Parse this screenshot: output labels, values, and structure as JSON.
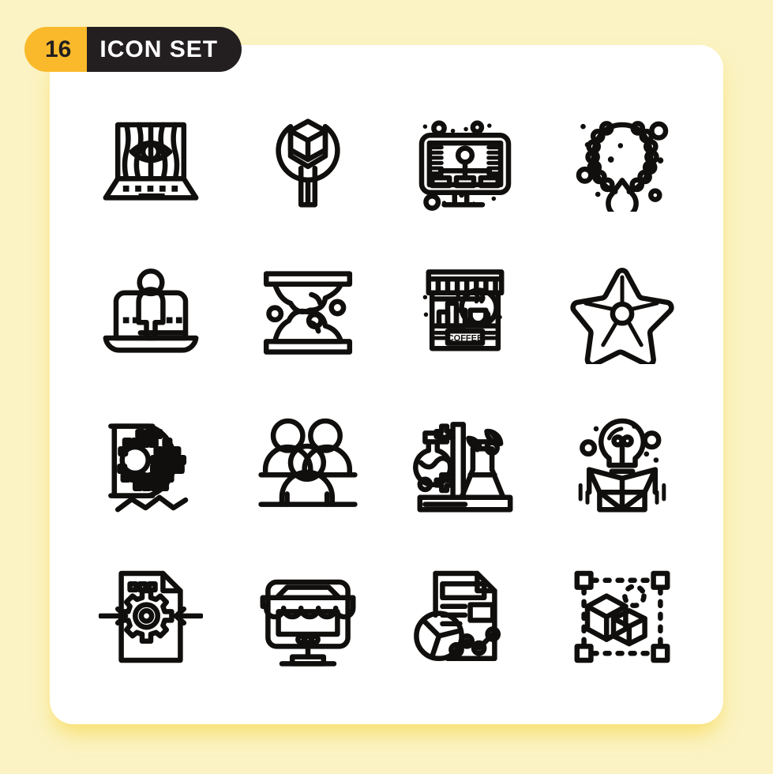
{
  "page": {
    "background_color": "#FBF3C3",
    "card_color": "#FFFFFF"
  },
  "badge": {
    "count": "16",
    "label": "ICON SET",
    "count_bg": "#F9B92B",
    "label_bg": "#231F20",
    "count_text_color": "#231F20",
    "label_text_color": "#FFFFFF"
  },
  "icons": {
    "stroke_color": "#100F0D",
    "count": 16,
    "grid": {
      "rows": 4,
      "columns": 4
    },
    "items": [
      {
        "position": "row1-col1",
        "name": "laptop-eye-surveillance-icon",
        "label": "Laptop with eye on screen"
      },
      {
        "position": "row1-col2",
        "name": "wrench-cube-icon",
        "label": "Wrench holding 3D cube"
      },
      {
        "position": "row1-col3",
        "name": "presentation-org-chart-icon",
        "label": "Monitor showing hierarchy chart"
      },
      {
        "position": "row1-col4",
        "name": "pearl-necklace-icon",
        "label": "Pearl necklace with teardrop pendant"
      },
      {
        "position": "row2-col1",
        "name": "laptop-user-icon",
        "label": "Laptop with person"
      },
      {
        "position": "row2-col2",
        "name": "hourglass-sand-icon",
        "label": "Hourglass with sand"
      },
      {
        "position": "row2-col3",
        "name": "coffee-shop-stall-icon",
        "label": "Coffee kiosk with awning",
        "sign_text": "COFFEE"
      },
      {
        "position": "row2-col4",
        "name": "starfish-icon",
        "label": "Starfish"
      },
      {
        "position": "row3-col1",
        "name": "halftone-letter-d-icon",
        "label": "Halftone dotted D shape with zigzag"
      },
      {
        "position": "row3-col2",
        "name": "people-group-icon",
        "label": "Group of three people"
      },
      {
        "position": "row3-col3",
        "name": "chemistry-lab-icon",
        "label": "Lab flasks with stand and leaves"
      },
      {
        "position": "row3-col4",
        "name": "lightbulb-box-idea-icon",
        "label": "Lightbulb rising from open box"
      },
      {
        "position": "row4-col1",
        "name": "document-gear-settings-icon",
        "label": "Document with gear and arrows"
      },
      {
        "position": "row4-col2",
        "name": "online-store-monitor-icon",
        "label": "Monitor with shop awning"
      },
      {
        "position": "row4-col3",
        "name": "report-analytics-icon",
        "label": "Document with pie chart and line graph"
      },
      {
        "position": "row4-col4",
        "name": "3d-cubes-selection-icon",
        "label": "3D cubes in selection bounding box"
      }
    ]
  }
}
